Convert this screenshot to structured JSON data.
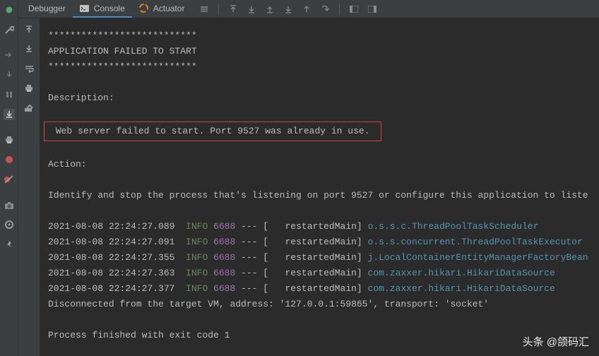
{
  "tabs": {
    "debugger": "Debugger",
    "console": "Console",
    "actuator": "Actuator"
  },
  "log": {
    "stars": "***************************",
    "title": "APPLICATION FAILED TO START",
    "desc_label": "Description:",
    "error_msg": "Web server failed to start. Port 9527 was already in use.",
    "action_label": "Action:",
    "action_text": "Identify and stop the process that's listening on port 9527 or configure this application to liste",
    "rows": [
      {
        "ts": "2021-08-08 22:24:27.089",
        "lvl": "INFO",
        "pid": "6688",
        "mid": " --- [   restartedMain] ",
        "pkg": "o.s.s.c.ThreadPoolTaskScheduler"
      },
      {
        "ts": "2021-08-08 22:24:27.091",
        "lvl": "INFO",
        "pid": "6688",
        "mid": " --- [   restartedMain] ",
        "pkg": "o.s.s.concurrent.ThreadPoolTaskExecutor"
      },
      {
        "ts": "2021-08-08 22:24:27.355",
        "lvl": "INFO",
        "pid": "6688",
        "mid": " --- [   restartedMain] ",
        "pkg": "j.LocalContainerEntityManagerFactoryBean"
      },
      {
        "ts": "2021-08-08 22:24:27.363",
        "lvl": "INFO",
        "pid": "6688",
        "mid": " --- [   restartedMain] ",
        "pkg": "com.zaxxer.hikari.HikariDataSource"
      },
      {
        "ts": "2021-08-08 22:24:27.377",
        "lvl": "INFO",
        "pid": "6688",
        "mid": " --- [   restartedMain] ",
        "pkg": "com.zaxxer.hikari.HikariDataSource"
      }
    ],
    "disconnect": "Disconnected from the target VM, address: '127.0.0.1:59865', transport: 'socket'",
    "exit": "Process finished with exit code 1"
  },
  "watermark": "头条 @颌码汇"
}
